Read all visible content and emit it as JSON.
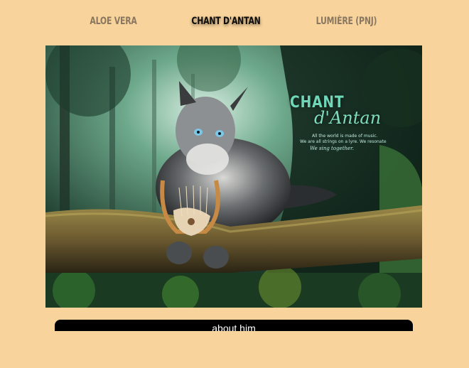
{
  "nav": {
    "tabs": [
      {
        "label": "ALOE VERA"
      },
      {
        "label": "CHANT D'ANTAN"
      },
      {
        "label": "LUMIÈRE (PNJ)"
      }
    ],
    "active_index": 1
  },
  "hero": {
    "title": "CHANT",
    "script": "d'Antan",
    "tagline_1": "All the world is made of music.",
    "tagline_2": "We are all strings on a lyre. We resonate",
    "tagline_3": "We sing together.",
    "icons": [
      "cat-illustration",
      "lyre-icon",
      "branch",
      "forest-background"
    ]
  },
  "about_button": {
    "label": "about him"
  },
  "colors": {
    "background": "#f8d39b",
    "tab_inactive": "#8a7760",
    "tab_active": "#0e0e0e",
    "title_accent": "#6fd6b7",
    "button": "#000000"
  }
}
